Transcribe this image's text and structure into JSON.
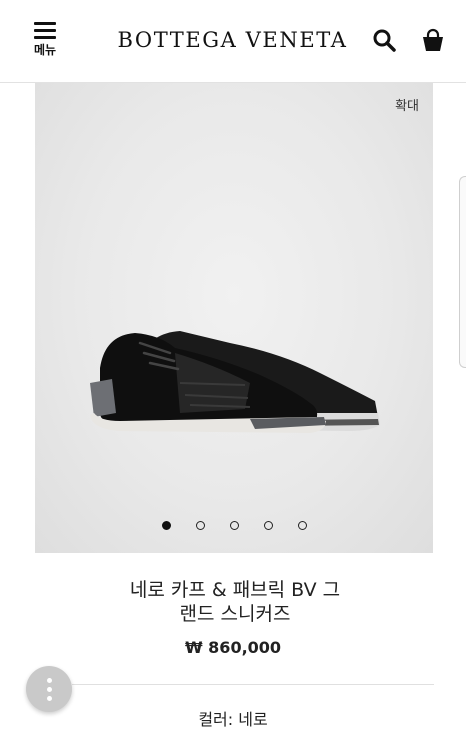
{
  "header": {
    "menu_label": "메뉴",
    "brand": "BOTTEGA VENETA",
    "search_icon": "search-icon",
    "bag_icon": "shopping-bag-icon"
  },
  "gallery": {
    "zoom_label": "확대",
    "image": "black-woven-sneakers",
    "slide_count": 5,
    "active_slide": 1
  },
  "product": {
    "title_line1": "네로 카프 & 패브릭 BV 그",
    "title_line2": "랜드 스니커즈",
    "price": "₩ 860,000",
    "color_label": "컬러: 네로"
  },
  "fab": {
    "icon": "more-vertical-icon"
  }
}
